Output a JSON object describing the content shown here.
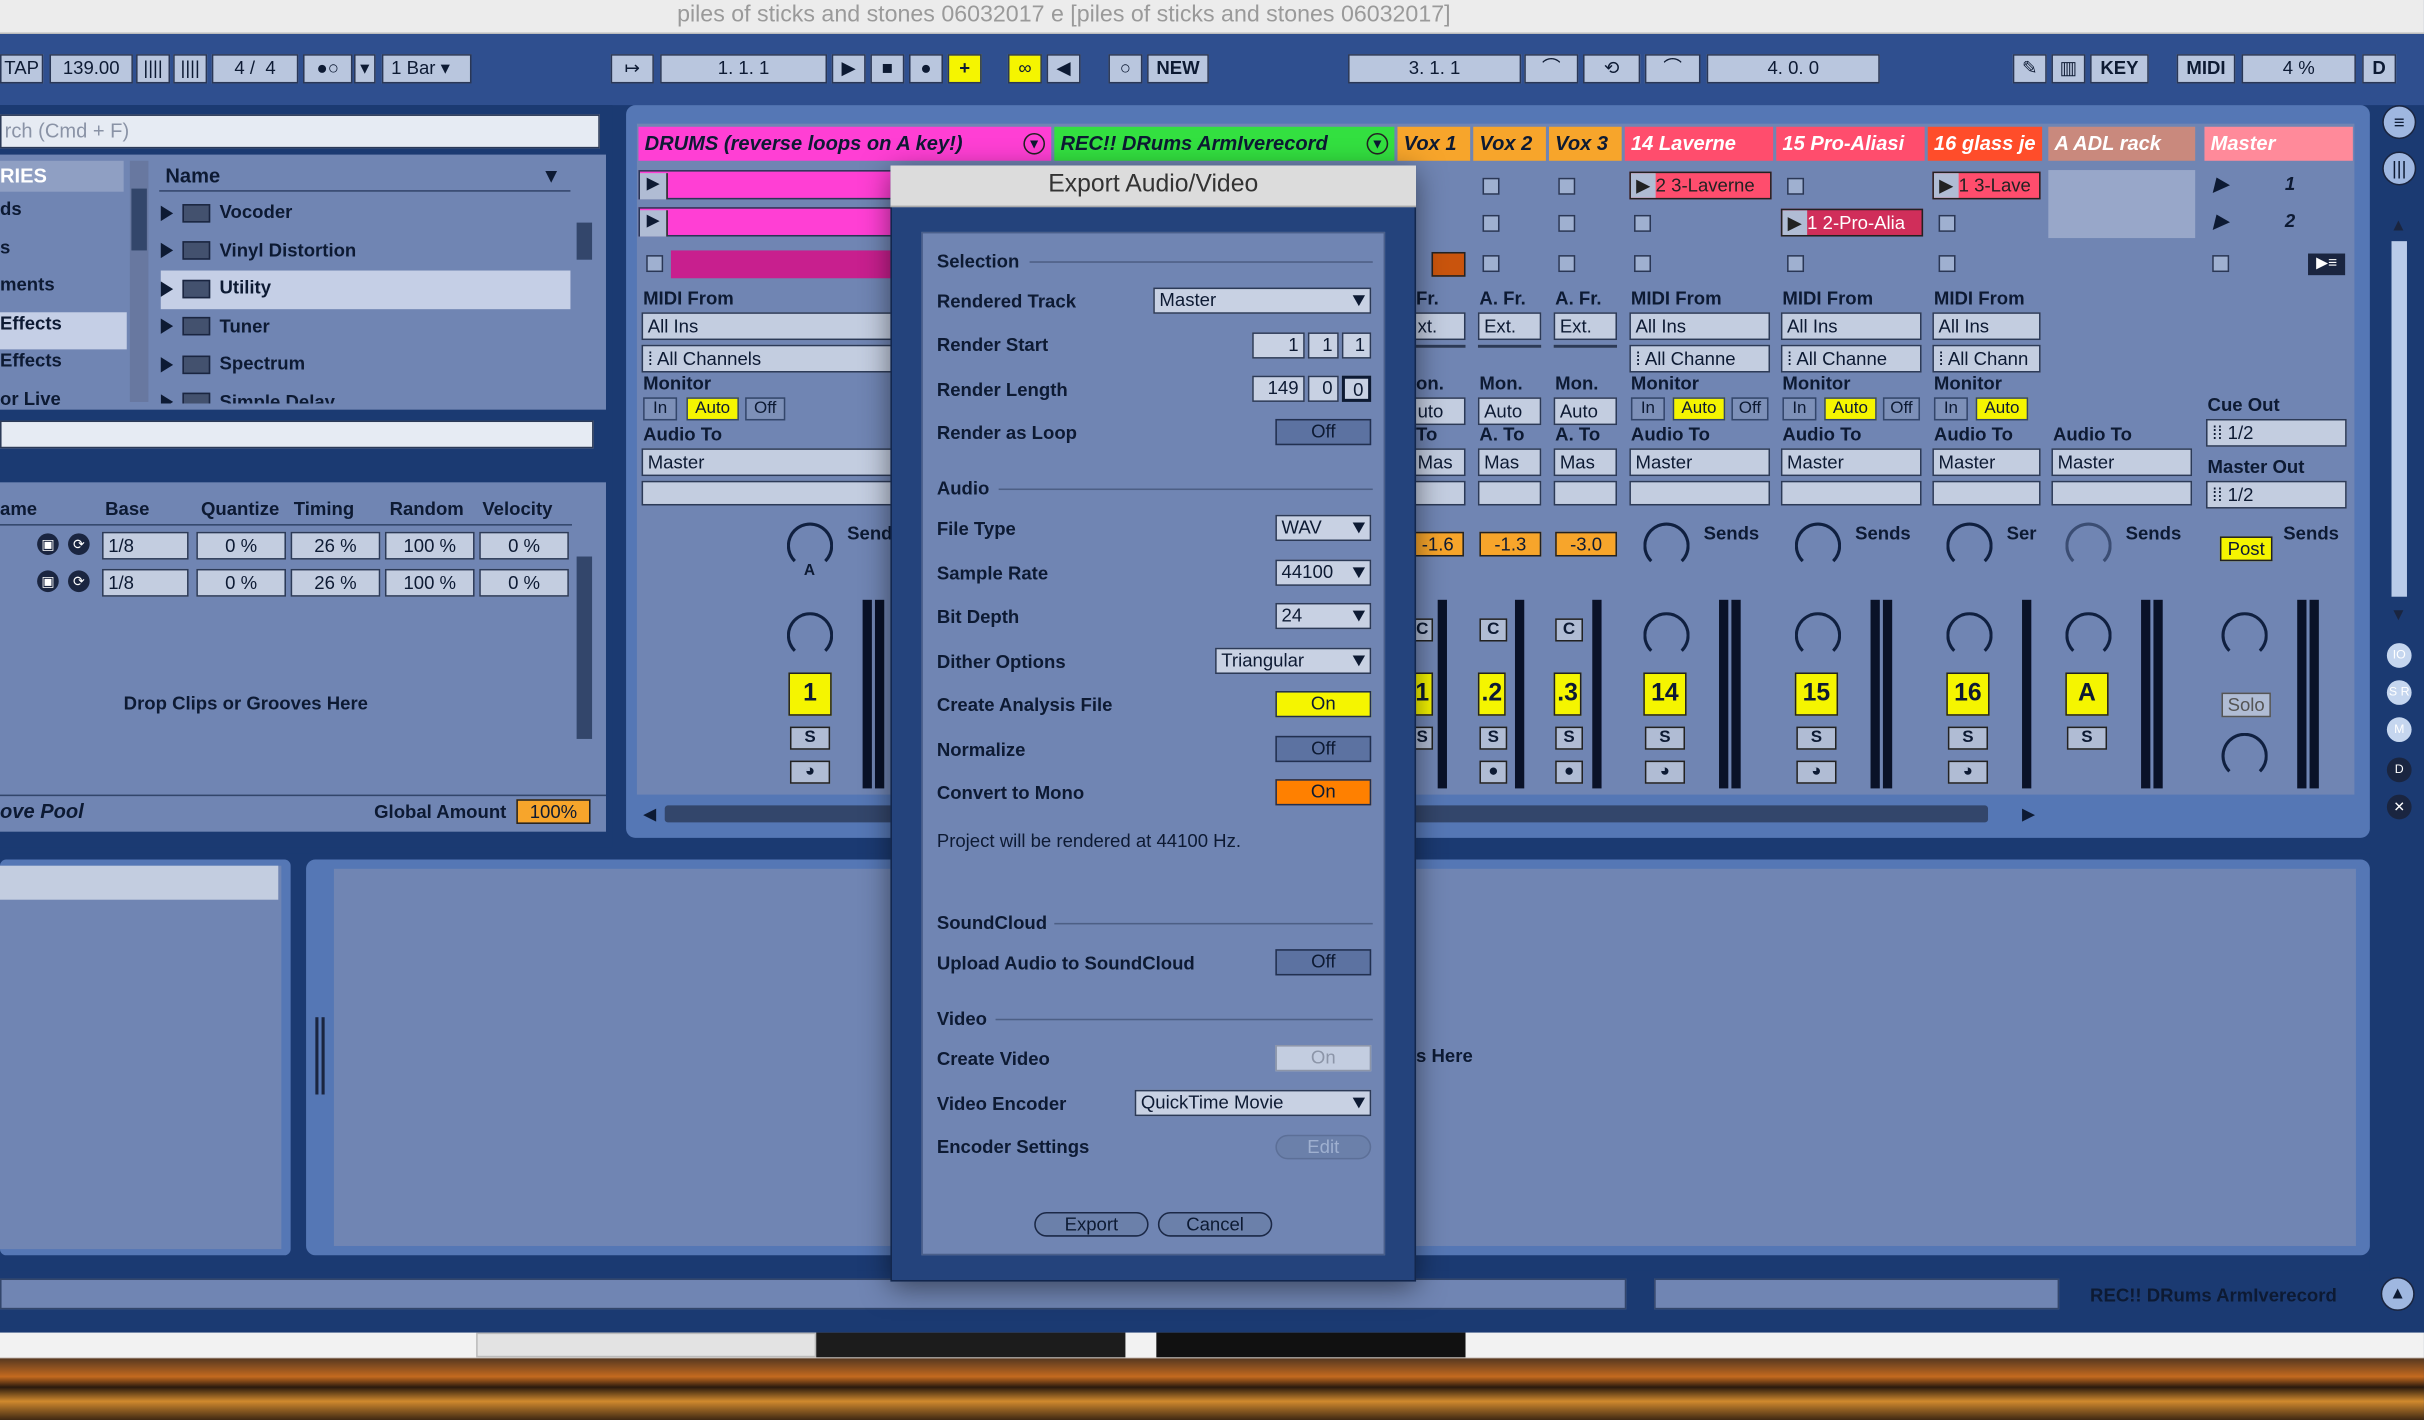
{
  "window": {
    "title": "piles of sticks and stones 06032017 e  [piles of sticks and stones 06032017]"
  },
  "transport": {
    "tap": "TAP",
    "tempo": "139.00",
    "sig_num": "4",
    "sig_den": "4",
    "quantize": "1 Bar",
    "position": "1.   1.   1",
    "new_label": "NEW",
    "loop_start": "3.   1.   1",
    "loop_length": "4.   0.   0",
    "key": "KEY",
    "midi": "MIDI",
    "cpu": "4 %",
    "d": "D"
  },
  "browser": {
    "search_placeholder": "rch (Cmd + F)",
    "cat_header": "RIES",
    "name_header": "Name",
    "categories": [
      "ds",
      "s",
      "ments",
      "Effects",
      "Effects",
      "or Live"
    ],
    "items": [
      "Vocoder",
      "Vinyl Distortion",
      "Utility",
      "Tuner",
      "Spectrum",
      "Simple Delay"
    ]
  },
  "groove": {
    "headers": [
      "ame",
      "Base",
      "Quantize",
      "Timing",
      "Random",
      "Velocity"
    ],
    "rows": [
      {
        "base": "1/8",
        "quantize": "0 %",
        "timing": "26 %",
        "random": "100 %",
        "velocity": "0 %"
      },
      {
        "base": "1/8",
        "quantize": "0 %",
        "timing": "26 %",
        "random": "100 %",
        "velocity": "0 %"
      }
    ],
    "drop_text": "Drop Clips or Grooves Here",
    "pool_label": "ove Pool",
    "global_label": "Global Amount",
    "global_value": "100%"
  },
  "tracks": {
    "t1": {
      "name": "DRUMS (reverse loops on A key!)",
      "color": "#ff3fd4",
      "midi_from": "MIDI From",
      "from": "All Ins",
      "channel": "All Channels",
      "monitor": "Monitor",
      "mon": [
        "In",
        "Auto",
        "Off"
      ],
      "audio_to": "Audio To",
      "to": "Master",
      "sends": "Send",
      "num": "1",
      "solo": "S"
    },
    "t2": {
      "name": "REC!! DRums ArmIverecord",
      "color": "#33e040"
    },
    "v1": {
      "name": "Vox 1",
      "color": "#f7a52b",
      "afr": "Fr.",
      "ext": "xt.",
      "mon": "on.",
      "auto": "uto",
      "ato": "To",
      "mas": "Mas",
      "val": "-1.6",
      "num": "1",
      "c": "C",
      "s": "S"
    },
    "v2": {
      "name": "Vox 2",
      "color": "#f7a52b",
      "afr": "A. Fr.",
      "ext": "Ext.",
      "mon": "Mon.",
      "auto": "Auto",
      "ato": "A. To",
      "mas": "Mas",
      "val": "-1.3",
      "num": ".2",
      "c": "C",
      "s": "S"
    },
    "v3": {
      "name": "Vox 3",
      "color": "#f7a52b",
      "afr": "A. Fr.",
      "ext": "Ext.",
      "mon": "Mon.",
      "auto": "Auto",
      "ato": "A. To",
      "mas": "Mas",
      "val": "-3.0",
      "num": ".3",
      "c": "C",
      "s": "S"
    },
    "t14": {
      "name": "14 Laverne",
      "color": "#ff4d6d",
      "clip": "2 3-Laverne",
      "midi_from": "MIDI From",
      "from": "All Ins",
      "channel": "All Channe",
      "monitor": "Monitor",
      "mon": [
        "In",
        "Auto",
        "Off"
      ],
      "audio_to": "Audio To",
      "to": "Master",
      "sends": "Sends",
      "num": "14",
      "s": "S"
    },
    "t15": {
      "name": "15 Pro-Aliasi",
      "color": "#ff4d6d",
      "clip": "1 2-Pro-Alia",
      "midi_from": "MIDI From",
      "from": "All Ins",
      "channel": "All Channe",
      "monitor": "Monitor",
      "mon": [
        "In",
        "Auto",
        "Off"
      ],
      "audio_to": "Audio To",
      "to": "Master",
      "sends": "Sends",
      "num": "15",
      "s": "S"
    },
    "t16": {
      "name": "16 glass je",
      "color": "#ff4d2a",
      "clip": "1 3-Lave",
      "midi_from": "MIDI From",
      "from": "All Ins",
      "channel": "All Chann",
      "monitor": "Monitor",
      "mon": [
        "In",
        "Auto"
      ],
      "audio_to": "Audio To",
      "to": "Master",
      "sends": "Ser",
      "num": "16",
      "s": "S"
    },
    "adl": {
      "name": "A ADL rack",
      "color": "#c9897d",
      "audio_to": "Audio To",
      "to": "Master",
      "sends": "Sends",
      "num": "A",
      "s": "S"
    },
    "master": {
      "name": "Master",
      "color": "#ff8a9a",
      "scenes": [
        "1",
        "2"
      ],
      "cue_out": "Cue Out",
      "cue": "1/2",
      "master_out": "Master Out",
      "mout": "1/2",
      "post": "Post",
      "sends": "Sends",
      "solo": "Solo"
    }
  },
  "status": {
    "track_label": "REC!! DRums ArmIverecord",
    "grooves_here": "ts Here"
  },
  "dialog": {
    "title": "Export Audio/Video",
    "selection": "Selection",
    "rendered_track_label": "Rendered Track",
    "rendered_track": "Master",
    "render_start_label": "Render Start",
    "render_start": [
      "1",
      "1",
      "1"
    ],
    "render_length_label": "Render Length",
    "render_length": [
      "149",
      "0",
      "0"
    ],
    "render_loop_label": "Render as Loop",
    "render_loop": "Off",
    "audio": "Audio",
    "file_type_label": "File Type",
    "file_type": "WAV",
    "sample_rate_label": "Sample Rate",
    "sample_rate": "44100",
    "bit_depth_label": "Bit Depth",
    "bit_depth": "24",
    "dither_label": "Dither Options",
    "dither": "Triangular",
    "analysis_label": "Create Analysis File",
    "analysis": "On",
    "normalize_label": "Normalize",
    "normalize": "Off",
    "mono_label": "Convert to Mono",
    "mono": "On",
    "info": "Project will be rendered at 44100 Hz.",
    "soundcloud": "SoundCloud",
    "upload_label": "Upload Audio to SoundCloud",
    "upload": "Off",
    "video": "Video",
    "create_video_label": "Create Video",
    "create_video": "On",
    "encoder_label": "Video Encoder",
    "encoder": "QuickTime Movie",
    "settings_label": "Encoder Settings",
    "edit": "Edit",
    "export": "Export",
    "cancel": "Cancel"
  },
  "colors": {
    "accent_yellow": "#f5f500",
    "accent_orange": "#ff8000",
    "panel": "#7085b3",
    "background": "#1b3a72"
  }
}
